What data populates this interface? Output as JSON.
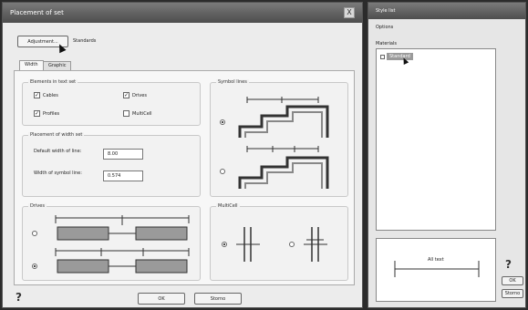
{
  "dialog": {
    "title": "Placement of set",
    "close_glyph": "X",
    "top_button_label": "Adjustment...",
    "standard_label": "Standards",
    "tabs": [
      {
        "label": "Width"
      },
      {
        "label": "Graphic"
      }
    ],
    "text_group": {
      "title": "Elements in text set",
      "checks": [
        {
          "label": "Cables",
          "checked": true
        },
        {
          "label": "Drives",
          "checked": true
        },
        {
          "label": "Profiles",
          "checked": true
        },
        {
          "label": "MultiCell",
          "checked": false
        }
      ]
    },
    "width_group": {
      "title": "Placement of width set",
      "fields": [
        {
          "label": "Default width of line:",
          "value": "8.00"
        },
        {
          "label": "Width of symbol line:",
          "value": "0.574"
        }
      ]
    },
    "drives_group": {
      "title": "Drives"
    },
    "symbols_group": {
      "title": "Symbol lines"
    },
    "multicell_group": {
      "title": "MultiCell"
    },
    "ok_label": "OK",
    "cancel_label": "Storno",
    "help_glyph": "?"
  },
  "side_pane": {
    "title": "Style list",
    "subtitle": "Options",
    "list_label": "Materials",
    "selected_item": "Standard",
    "preview_label": "All text",
    "help_glyph": "?",
    "ok_label": "OK",
    "cancel_label": "Storno"
  }
}
